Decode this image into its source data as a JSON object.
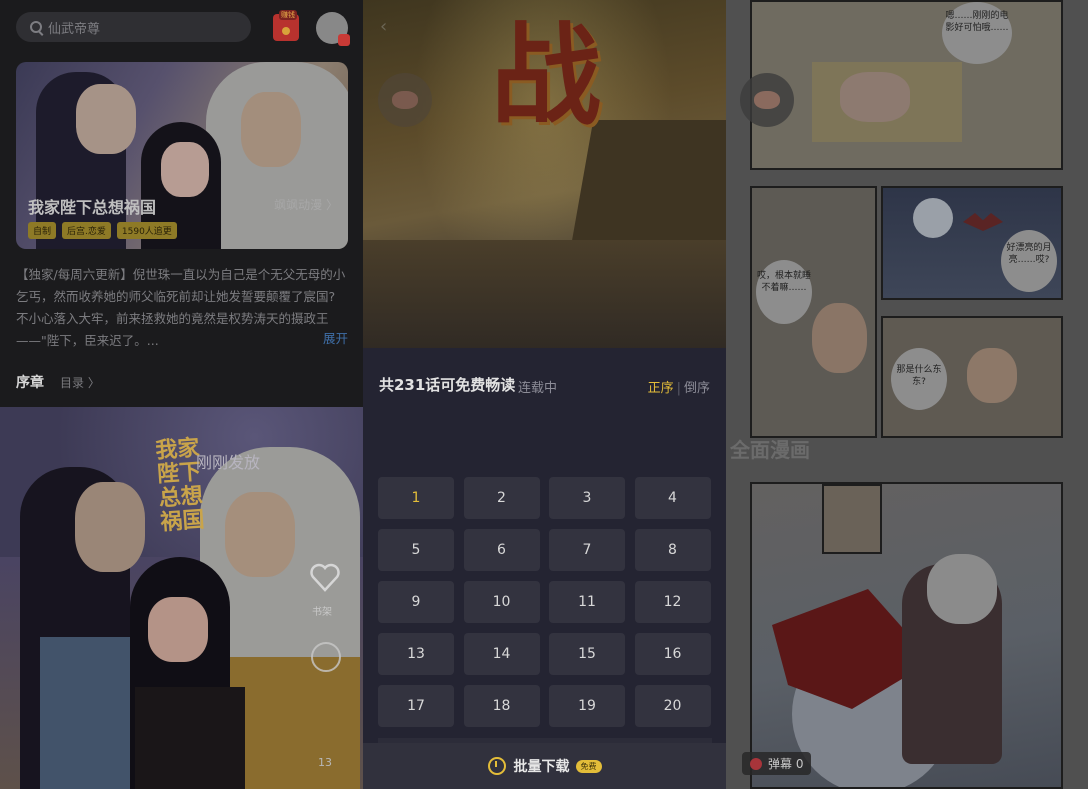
{
  "left": {
    "search": {
      "placeholder": "仙武帝尊"
    },
    "redpack": {
      "tag": "赚钱"
    },
    "banner": {
      "title": "我家陛下总想祸国",
      "studio": "飒飒动漫 〉",
      "tags": [
        "自制",
        "后宫.恋爱",
        "1590人追更"
      ]
    },
    "description": "【独家/每周六更新】倪世珠一直以为自己是个无父无母的小乞丐，然而收养她的师父临死前却让她发誓要颠覆了宸国? 不小心落入大牢，前来拯救她的竟然是权势涛天的摄政王——\"陛下，臣来迟了。...",
    "expand": "展开",
    "prologue": "序章",
    "toc": "目录 〉",
    "poster": {
      "logo": "我家陛下总想祸国",
      "tagline": "刚刚发放"
    },
    "favorite_label": "书架",
    "count": "13"
  },
  "middle": {
    "header": "共231话可免费畅读",
    "status": "连载中",
    "order_asc": "正序",
    "order_sep": "|",
    "order_desc": "倒序",
    "chapters": [
      "1",
      "2",
      "3",
      "4",
      "5",
      "6",
      "7",
      "8",
      "9",
      "10",
      "11",
      "12",
      "13",
      "14",
      "15",
      "16",
      "17",
      "18",
      "19",
      "20"
    ],
    "selected_chapter": "1",
    "batch_download": "批量下载",
    "free_badge": "免费",
    "cover_glyph": "战",
    "accent_color": "#e3bd39"
  },
  "right": {
    "bubbles": {
      "b1": "嗯……刚刚的电影好可怕哦……",
      "b2": "哎，根本就睡不着嘛……",
      "b3": "好漂亮的月亮……哎?",
      "b4": "那是什么东东?"
    },
    "watermark": "全面漫画",
    "danmu": "弹幕 0"
  }
}
